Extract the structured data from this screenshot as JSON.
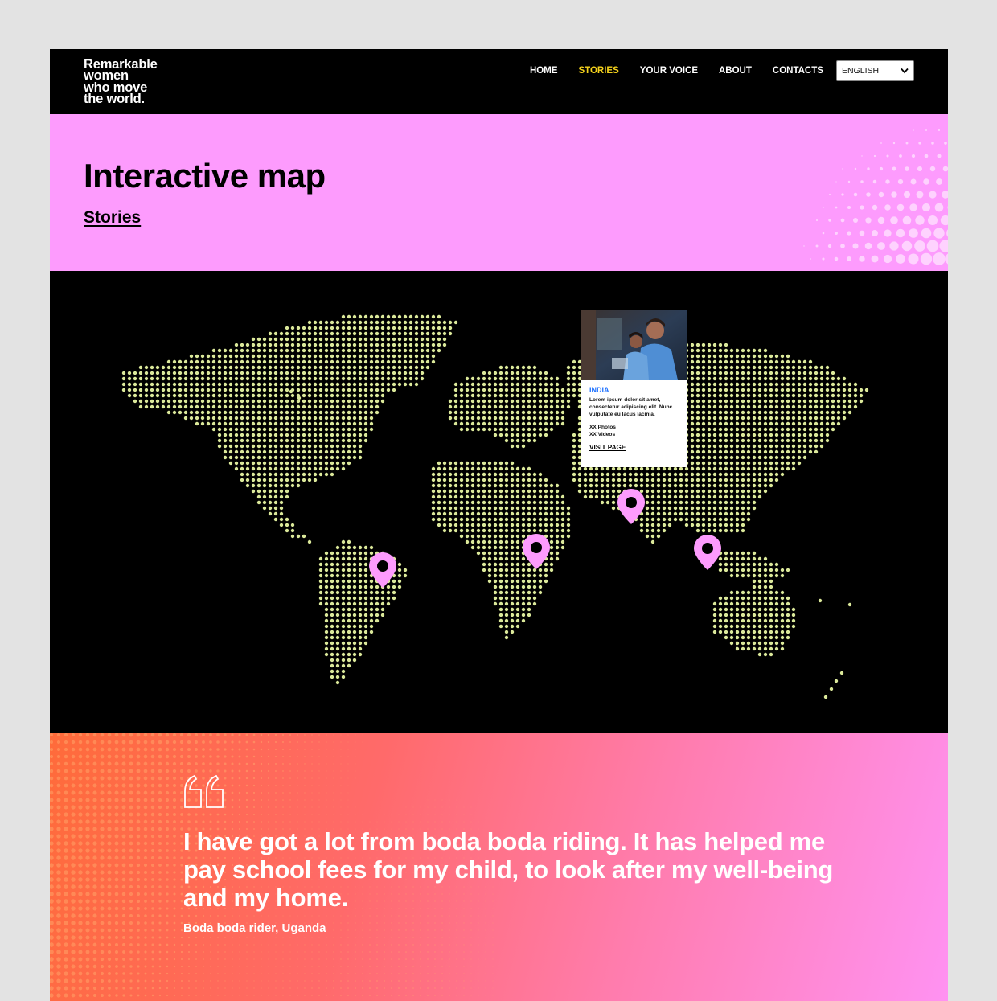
{
  "brand": {
    "logo_lines": [
      "Remarkable",
      "women",
      "who move",
      "the world."
    ]
  },
  "nav": {
    "items": [
      "HOME",
      "STORIES",
      "YOUR VOICE",
      "ABOUT",
      "CONTACTS"
    ],
    "active": "STORIES",
    "language": "ENGLISH"
  },
  "hero": {
    "title": "Interactive map",
    "link": "Stories"
  },
  "map": {
    "dot_color": "#dbe89a",
    "pin_color": "#fd9bfd",
    "pins": [
      "brazil-pin",
      "east-africa-pin",
      "india-pin",
      "southeast-asia-pin"
    ],
    "card": {
      "country": "INDIA",
      "text": "Lorem ipsum dolor sit amet, consectetur adipiscing elit. Nunc vulputate eu lacus lacinia.",
      "photos": "XX Photos",
      "videos": "XX Videos",
      "link": "VISIT PAGE"
    }
  },
  "quote": {
    "text": "I have got a lot from boda boda riding. It has helped me pay school fees for my child, to look after my well-being and my home.",
    "author": "Boda boda rider, Uganda"
  },
  "colors": {
    "accent_nav": "#f5d21c",
    "hero_bg": "#fd9bfd",
    "card_country": "#1f72ff"
  }
}
